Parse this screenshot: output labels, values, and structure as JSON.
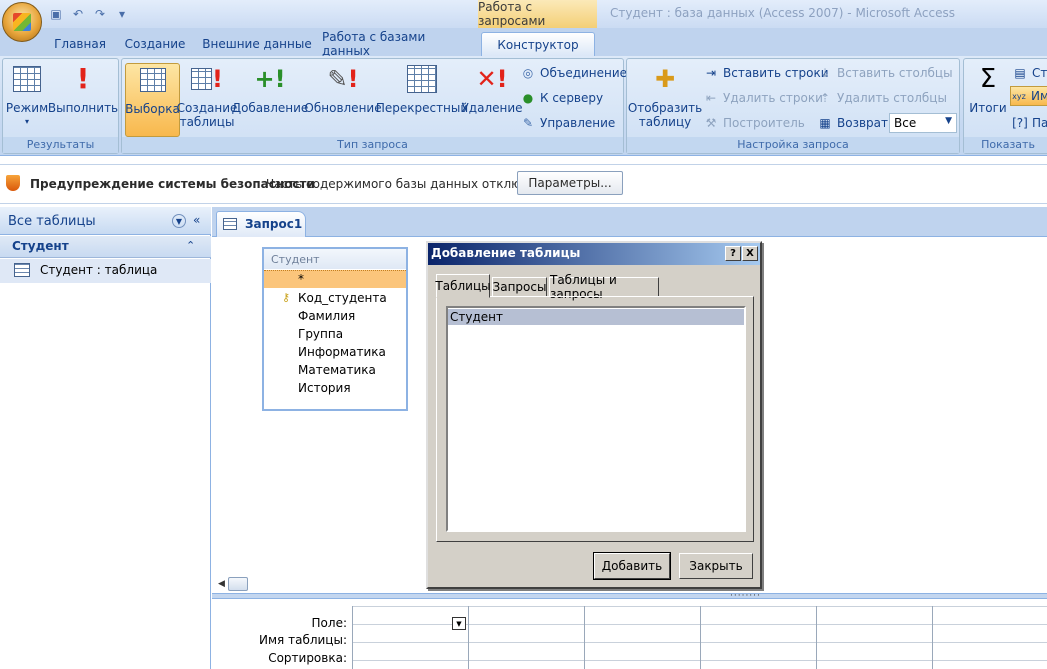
{
  "title_bar": {
    "context_tab": "Работа с запросами",
    "window_title": "Студент : база данных (Access 2007) - Microsoft Access"
  },
  "quick_access": {
    "icons": [
      "save-icon",
      "undo-icon",
      "redo-icon",
      "customize-icon"
    ]
  },
  "tabs": [
    {
      "label": "Главная"
    },
    {
      "label": "Создание"
    },
    {
      "label": "Внешние данные"
    },
    {
      "label": "Работа с базами данных"
    },
    {
      "label": "Конструктор",
      "active": true
    }
  ],
  "ribbon": {
    "results": {
      "label": "Результаты",
      "mode": "Режим",
      "run": "Выполнить"
    },
    "query_type": {
      "label": "Тип запроса",
      "select": "Выборка",
      "make_table_1": "Создание",
      "make_table_2": "таблицы",
      "append": "Добавление",
      "update": "Обновление",
      "crosstab": "Перекрестный",
      "delete": "Удаление",
      "union": "Объединение",
      "server": "К серверу",
      "manage": "Управление"
    },
    "setup": {
      "label": "Настройка запроса",
      "show_table_1": "Отобразить",
      "show_table_2": "таблицу",
      "insert_rows": "Вставить строки",
      "delete_rows": "Удалить строки",
      "builder": "Построитель",
      "insert_cols": "Вставить столбцы",
      "delete_cols": "Удалить столбцы",
      "return_label": "Возврат:",
      "return_value": "Все"
    },
    "show": {
      "label": "Показать",
      "totals": "Итоги",
      "item1": "Стр",
      "item2": "Им",
      "item3": "Па"
    }
  },
  "security": {
    "title": "Предупреждение системы безопасности",
    "text": "Часть содержимого базы данных отключено",
    "button": "Параметры..."
  },
  "nav": {
    "header": "Все таблицы",
    "group": "Студент",
    "item": "Студент : таблица"
  },
  "document": {
    "tab": "Запрос1",
    "field_list": {
      "title": "Студент",
      "fields": [
        "*",
        "Код_студента",
        "Фамилия",
        "Группа",
        "Информатика",
        "Математика",
        "История"
      ]
    },
    "grid": {
      "rows": [
        "Поле:",
        "Имя таблицы:",
        "Сортировка:"
      ]
    }
  },
  "dialog": {
    "title": "Добавление таблицы",
    "help": "?",
    "close": "X",
    "tabs": [
      "Таблицы",
      "Запросы",
      "Таблицы и запросы"
    ],
    "items": [
      "Студент"
    ],
    "add_button": "Добавить",
    "close_button": "Закрыть"
  }
}
